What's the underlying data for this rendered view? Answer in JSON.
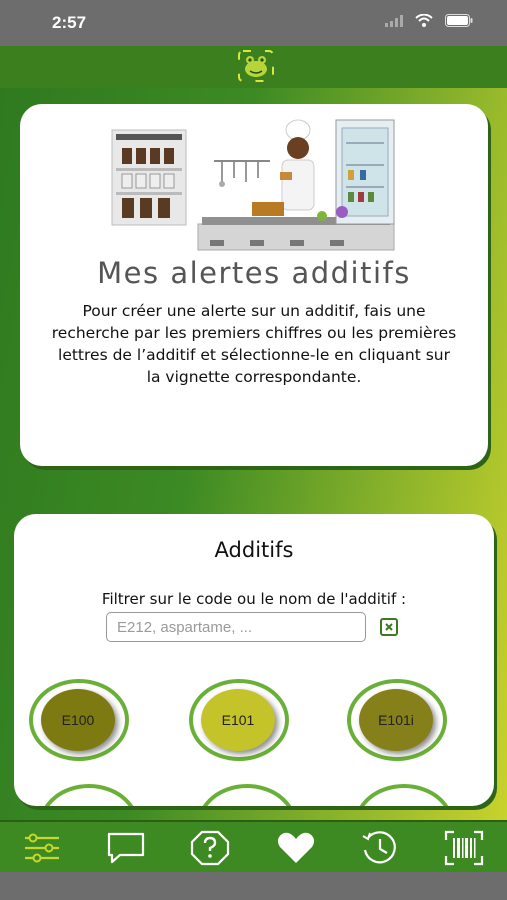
{
  "status": {
    "time": "2:57"
  },
  "intro": {
    "title": "Mes alertes additifs",
    "text": "Pour créer une alerte sur un additif, fais une recherche par les premiers chiffres ou les premières lettres de l’additif et sélectionne-le en cliquant sur la vignette correspondante."
  },
  "additifs": {
    "title": "Additifs",
    "filter_label": "Filtrer sur le code ou le nom de l'additif :",
    "search": {
      "value": "",
      "placeholder": "E212, aspartame, ..."
    },
    "items": [
      {
        "code": "E100",
        "color": "#7d7a12"
      },
      {
        "code": "E101",
        "color": "#c4c42a"
      },
      {
        "code": "E101i",
        "color": "#86801a"
      }
    ]
  },
  "nav": {
    "items": [
      "filter-icon",
      "chat-icon",
      "help-icon",
      "heart-icon",
      "history-icon",
      "barcode-icon"
    ],
    "active": "filter-icon"
  },
  "colors": {
    "header_green": "#3b7f1f",
    "badge_ring": "#6ab038",
    "nav_active": "#c5d82c"
  }
}
